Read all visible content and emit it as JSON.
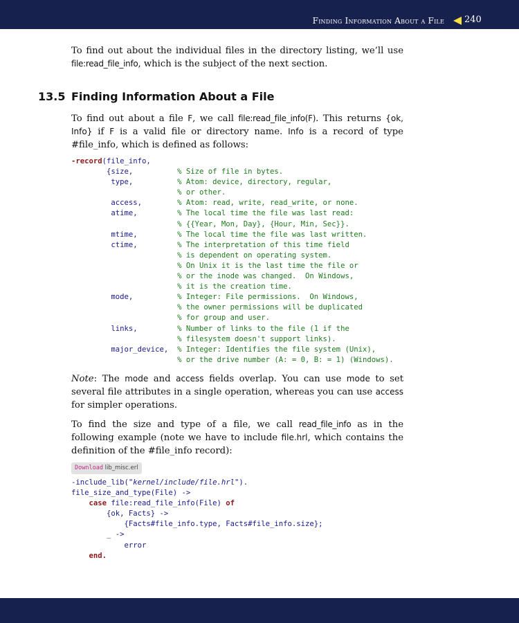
{
  "header": {
    "running_title": "Finding Information About a File",
    "page_number": "240"
  },
  "intro": {
    "t1": "To find out about the individual files in the directory listing, we’ll use ",
    "c1": "file:read_file_info",
    "t2": ", which is the subject of the next section."
  },
  "section": {
    "number": "13.5",
    "title": "Finding Information About a File"
  },
  "para1": {
    "t1": "To find out about a file ",
    "c1": "F",
    "t2": ", we call ",
    "c2": "file:read_file_info(F)",
    "t3": ". This returns ",
    "c3": "{ok, Info}",
    "t4": " if ",
    "c4": "F",
    "t5": " is a valid file or directory name. ",
    "c5": "Info",
    "t6": " is a record of type ",
    "c6": "#file_info",
    "t7": ", which is defined as follows:"
  },
  "record_code": {
    "head_kw": "-record",
    "head_rest": "(file_info,",
    "lines": [
      {
        "field": "        {size,          ",
        "comment": "% Size of file in bytes."
      },
      {
        "field": "         type,          ",
        "comment": "% Atom: device, directory, regular,"
      },
      {
        "field": "                        ",
        "comment": "% or other."
      },
      {
        "field": "         access,        ",
        "comment": "% Atom: read, write, read_write, or none."
      },
      {
        "field": "         atime,         ",
        "comment": "% The local time the file was last read:"
      },
      {
        "field": "                        ",
        "comment": "% {{Year, Mon, Day}, {Hour, Min, Sec}}."
      },
      {
        "field": "         mtime,         ",
        "comment": "% The local time the file was last written."
      },
      {
        "field": "         ctime,         ",
        "comment": "% The interpretation of this time field"
      },
      {
        "field": "                        ",
        "comment": "% is dependent on operating system."
      },
      {
        "field": "                        ",
        "comment": "% On Unix it is the last time the file or"
      },
      {
        "field": "                        ",
        "comment": "% or the inode was changed.  On Windows,"
      },
      {
        "field": "                        ",
        "comment": "% it is the creation time."
      },
      {
        "field": "         mode,          ",
        "comment": "% Integer: File permissions.  On Windows,"
      },
      {
        "field": "                        ",
        "comment": "% the owner permissions will be duplicated"
      },
      {
        "field": "                        ",
        "comment": "% for group and user."
      },
      {
        "field": "         links,         ",
        "comment": "% Number of links to the file (1 if the"
      },
      {
        "field": "                        ",
        "comment": "% filesystem doesn't support links)."
      },
      {
        "field": "         major_device,  ",
        "comment": "% Integer: Identifies the file system (Unix),"
      },
      {
        "field": "                        ",
        "comment": "% or the drive number (A: = 0, B: = 1) (Windows)."
      }
    ]
  },
  "note": {
    "label": "Note",
    "t1": ": The ",
    "c1": "mode",
    "t2": " and ",
    "c2": "access",
    "t3": " fields overlap. You can use ",
    "c3": "mode",
    "t4": " to set several file attributes in a single operation, whereas you can use ",
    "c4": "access",
    "t5": " for simpler operations."
  },
  "para2": {
    "t1": "To find the size and type of a file, we call ",
    "c1": "read_file_info",
    "t2": " as in the following example (note we have to include ",
    "c2": "file.hrl",
    "t3": ", which contains the definition of the ",
    "c3": "#file_info",
    "t4": " record):"
  },
  "download": {
    "label": "Download",
    "file": "lib_misc.erl"
  },
  "example_code": {
    "l1a": "-include_lib(",
    "l1s": "\"kernel/include/file.hrl\"",
    "l1b": ").",
    "l2": "file_size_and_type(File) ->",
    "l3_indent": "    ",
    "l3_kw": "case",
    "l3_mid": " file:read_file_info(File) ",
    "l3_kw2": "of",
    "l4": "        {ok, Facts} ->",
    "l5": "            {Facts#file_info.type, Facts#file_info.size};",
    "l6": "        _ ->",
    "l7": "            error",
    "l8_indent": "    ",
    "l8_kw": "end."
  }
}
